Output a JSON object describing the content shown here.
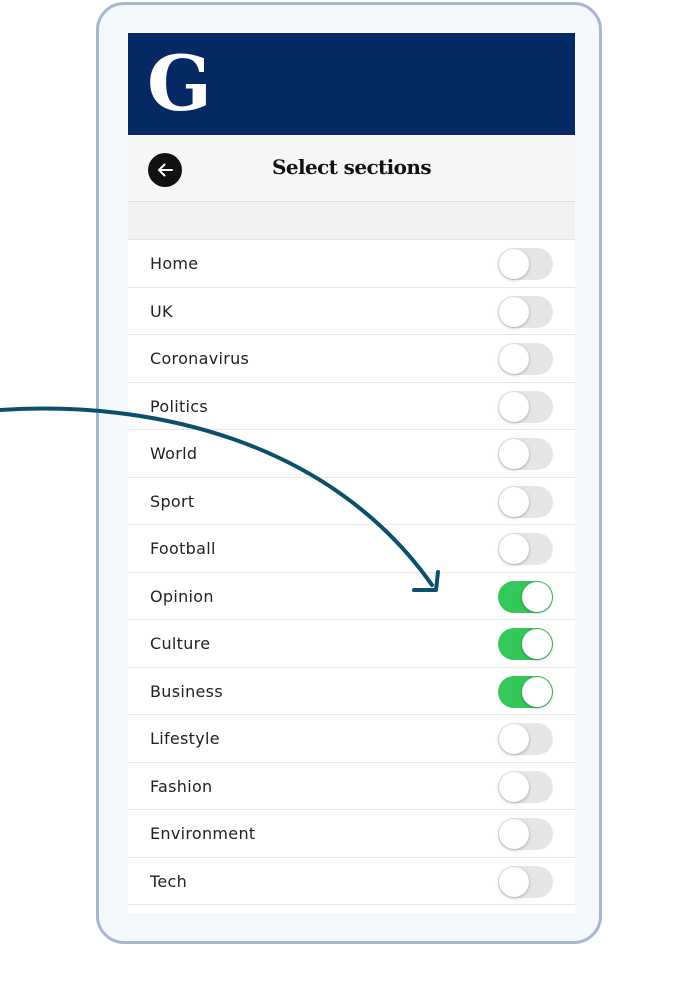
{
  "app": {
    "logo": "G",
    "title": "Select sections"
  },
  "colors": {
    "masthead": "#052962",
    "toggle_on": "#34c759",
    "toggle_off": "#e6e6e8",
    "arrow": "#0b4f6c"
  },
  "back_icon": "arrow-left-icon",
  "sections": [
    {
      "label": "Home",
      "enabled": false
    },
    {
      "label": "UK",
      "enabled": false
    },
    {
      "label": "Coronavirus",
      "enabled": false
    },
    {
      "label": "Politics",
      "enabled": false
    },
    {
      "label": "World",
      "enabled": false
    },
    {
      "label": "Sport",
      "enabled": false
    },
    {
      "label": "Football",
      "enabled": false
    },
    {
      "label": "Opinion",
      "enabled": true
    },
    {
      "label": "Culture",
      "enabled": true
    },
    {
      "label": "Business",
      "enabled": true
    },
    {
      "label": "Lifestyle",
      "enabled": false
    },
    {
      "label": "Fashion",
      "enabled": false
    },
    {
      "label": "Environment",
      "enabled": false
    },
    {
      "label": "Tech",
      "enabled": false
    }
  ]
}
